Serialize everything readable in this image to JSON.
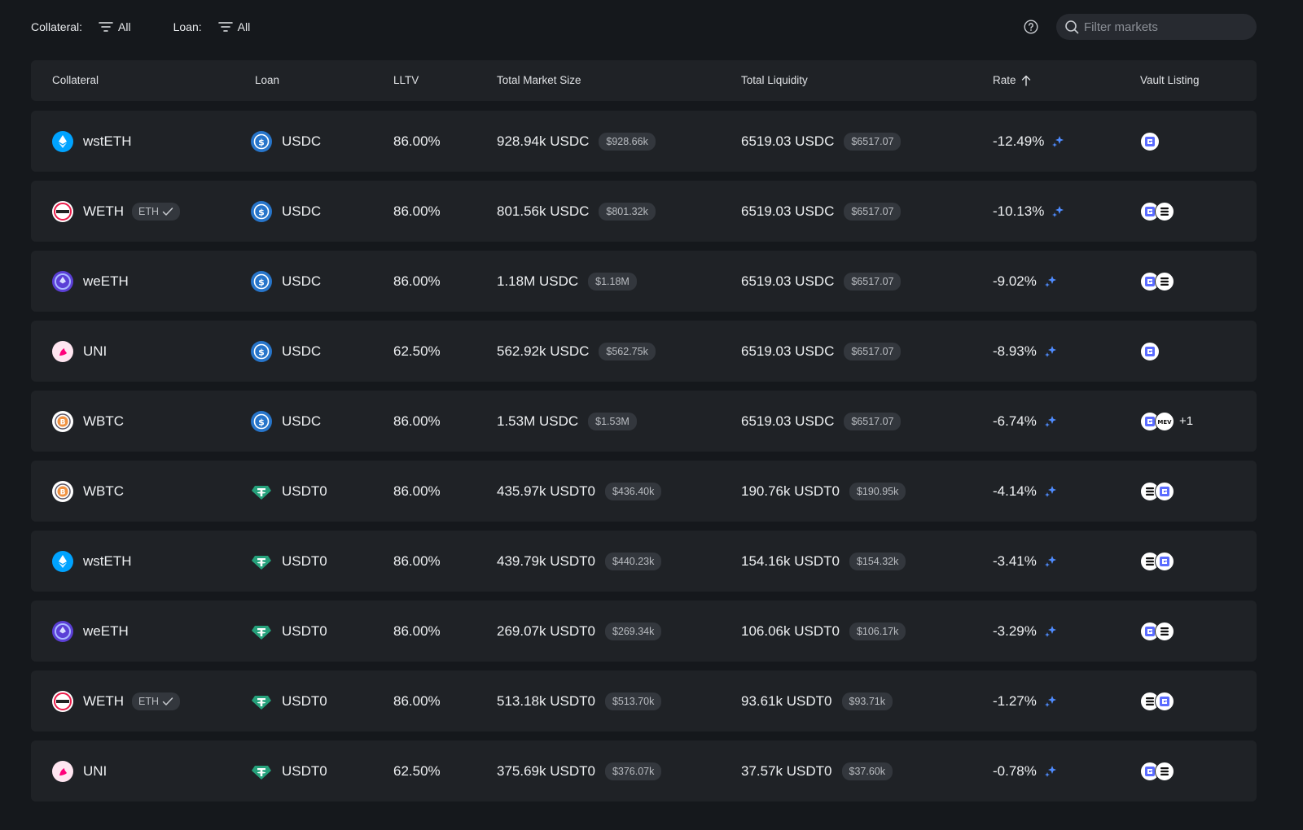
{
  "filters": {
    "collateral_label": "Collateral:",
    "collateral_value": "All",
    "loan_label": "Loan:",
    "loan_value": "All",
    "search_placeholder": "Filter markets"
  },
  "columns": {
    "collateral": "Collateral",
    "loan": "Loan",
    "lltv": "LLTV",
    "size": "Total Market Size",
    "liquidity": "Total Liquidity",
    "rate": "Rate",
    "vault": "Vault Listing"
  },
  "colors": {
    "background": "#15181c",
    "row": "#1f2226",
    "accent_sparkle": "#4f8cff",
    "usdc": "#2775ca",
    "usdt0": "#26a17b"
  },
  "rows": [
    {
      "collateral": "wstETH",
      "collateral_icon": "wsteth-icon",
      "tag": "",
      "loan": "USDC",
      "loan_icon": "usdc-icon",
      "lltv": "86.00%",
      "size": "928.94k USDC",
      "size_usd": "$928.66k",
      "liquidity": "6519.03 USDC",
      "liquidity_usd": "$6517.07",
      "rate": "-12.49%",
      "vaults": [
        "gauntlet-icon"
      ],
      "vault_extra": ""
    },
    {
      "collateral": "WETH",
      "collateral_icon": "weth-icon",
      "tag": "ETH",
      "loan": "USDC",
      "loan_icon": "usdc-icon",
      "lltv": "86.00%",
      "size": "801.56k USDC",
      "size_usd": "$801.32k",
      "liquidity": "6519.03 USDC",
      "liquidity_usd": "$6517.07",
      "rate": "-10.13%",
      "vaults": [
        "gauntlet-icon",
        "steakhouse-icon"
      ],
      "vault_extra": ""
    },
    {
      "collateral": "weETH",
      "collateral_icon": "weeth-icon",
      "tag": "",
      "loan": "USDC",
      "loan_icon": "usdc-icon",
      "lltv": "86.00%",
      "size": "1.18M USDC",
      "size_usd": "$1.18M",
      "liquidity": "6519.03 USDC",
      "liquidity_usd": "$6517.07",
      "rate": "-9.02%",
      "vaults": [
        "gauntlet-icon",
        "steakhouse-icon"
      ],
      "vault_extra": ""
    },
    {
      "collateral": "UNI",
      "collateral_icon": "uni-icon",
      "tag": "",
      "loan": "USDC",
      "loan_icon": "usdc-icon",
      "lltv": "62.50%",
      "size": "562.92k USDC",
      "size_usd": "$562.75k",
      "liquidity": "6519.03 USDC",
      "liquidity_usd": "$6517.07",
      "rate": "-8.93%",
      "vaults": [
        "gauntlet-icon"
      ],
      "vault_extra": ""
    },
    {
      "collateral": "WBTC",
      "collateral_icon": "wbtc-icon",
      "tag": "",
      "loan": "USDC",
      "loan_icon": "usdc-icon",
      "lltv": "86.00%",
      "size": "1.53M USDC",
      "size_usd": "$1.53M",
      "liquidity": "6519.03 USDC",
      "liquidity_usd": "$6517.07",
      "rate": "-6.74%",
      "vaults": [
        "gauntlet-icon",
        "mev-icon"
      ],
      "vault_extra": "+1"
    },
    {
      "collateral": "WBTC",
      "collateral_icon": "wbtc-icon",
      "tag": "",
      "loan": "USDT0",
      "loan_icon": "usdt0-icon",
      "lltv": "86.00%",
      "size": "435.97k USDT0",
      "size_usd": "$436.40k",
      "liquidity": "190.76k USDT0",
      "liquidity_usd": "$190.95k",
      "rate": "-4.14%",
      "vaults": [
        "steakhouse-icon",
        "gauntlet-icon"
      ],
      "vault_extra": ""
    },
    {
      "collateral": "wstETH",
      "collateral_icon": "wsteth-icon",
      "tag": "",
      "loan": "USDT0",
      "loan_icon": "usdt0-icon",
      "lltv": "86.00%",
      "size": "439.79k USDT0",
      "size_usd": "$440.23k",
      "liquidity": "154.16k USDT0",
      "liquidity_usd": "$154.32k",
      "rate": "-3.41%",
      "vaults": [
        "steakhouse-icon",
        "gauntlet-icon"
      ],
      "vault_extra": ""
    },
    {
      "collateral": "weETH",
      "collateral_icon": "weeth-icon",
      "tag": "",
      "loan": "USDT0",
      "loan_icon": "usdt0-icon",
      "lltv": "86.00%",
      "size": "269.07k USDT0",
      "size_usd": "$269.34k",
      "liquidity": "106.06k USDT0",
      "liquidity_usd": "$106.17k",
      "rate": "-3.29%",
      "vaults": [
        "gauntlet-icon",
        "steakhouse-icon"
      ],
      "vault_extra": ""
    },
    {
      "collateral": "WETH",
      "collateral_icon": "weth-icon",
      "tag": "ETH",
      "loan": "USDT0",
      "loan_icon": "usdt0-icon",
      "lltv": "86.00%",
      "size": "513.18k USDT0",
      "size_usd": "$513.70k",
      "liquidity": "93.61k USDT0",
      "liquidity_usd": "$93.71k",
      "rate": "-1.27%",
      "vaults": [
        "steakhouse-icon",
        "gauntlet-icon"
      ],
      "vault_extra": ""
    },
    {
      "collateral": "UNI",
      "collateral_icon": "uni-icon",
      "tag": "",
      "loan": "USDT0",
      "loan_icon": "usdt0-icon",
      "lltv": "62.50%",
      "size": "375.69k USDT0",
      "size_usd": "$376.07k",
      "liquidity": "37.57k USDT0",
      "liquidity_usd": "$37.60k",
      "rate": "-0.78%",
      "vaults": [
        "gauntlet-icon",
        "steakhouse-icon"
      ],
      "vault_extra": ""
    }
  ]
}
